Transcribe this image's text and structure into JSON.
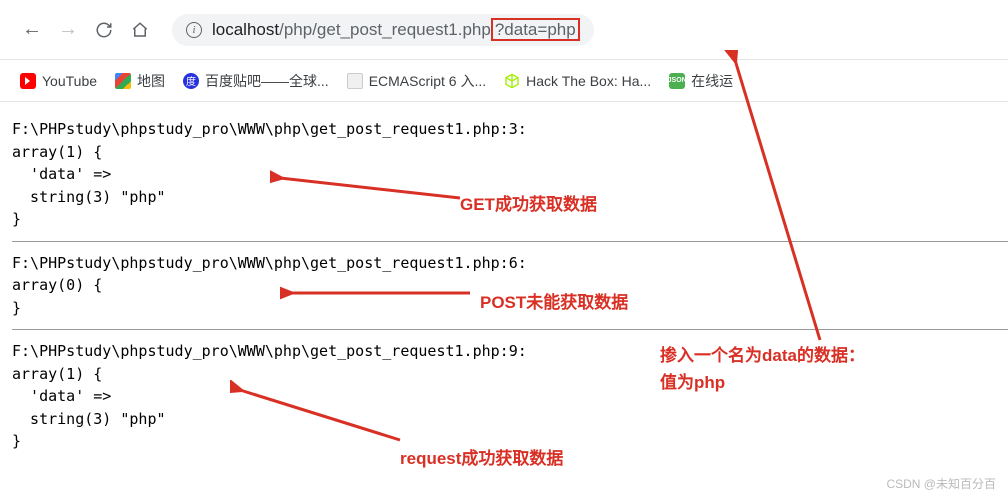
{
  "url": {
    "host": "localhost",
    "path": "/php/get_post_request1.php",
    "query": "?data=php"
  },
  "bookmarks": [
    {
      "label": "YouTube",
      "icon": "youtube"
    },
    {
      "label": "地图",
      "icon": "maps"
    },
    {
      "label": "百度贴吧——全球...",
      "icon": "baidu"
    },
    {
      "label": "ECMAScript 6 入...",
      "icon": "ecma"
    },
    {
      "label": "Hack The Box: Ha...",
      "icon": "box"
    },
    {
      "label": "在线运",
      "icon": "json"
    }
  ],
  "outputs": {
    "get": "F:\\PHPstudy\\phpstudy_pro\\WWW\\php\\get_post_request1.php:3:\narray(1) {\n  'data' =>\n  string(3) \"php\"\n}",
    "post": "F:\\PHPstudy\\phpstudy_pro\\WWW\\php\\get_post_request1.php:6:\narray(0) {\n}",
    "request": "F:\\PHPstudy\\phpstudy_pro\\WWW\\php\\get_post_request1.php:9:\narray(1) {\n  'data' =>\n  string(3) \"php\"\n}"
  },
  "annotations": {
    "get": "GET成功获取数据",
    "post": "POST未能获取数据",
    "request": "request成功获取数据",
    "data_line1": "掺入一个名为data的数据：",
    "data_line2": "值为php"
  },
  "watermark": "CSDN @未知百分百",
  "colors": {
    "annotation": "#d93025"
  }
}
